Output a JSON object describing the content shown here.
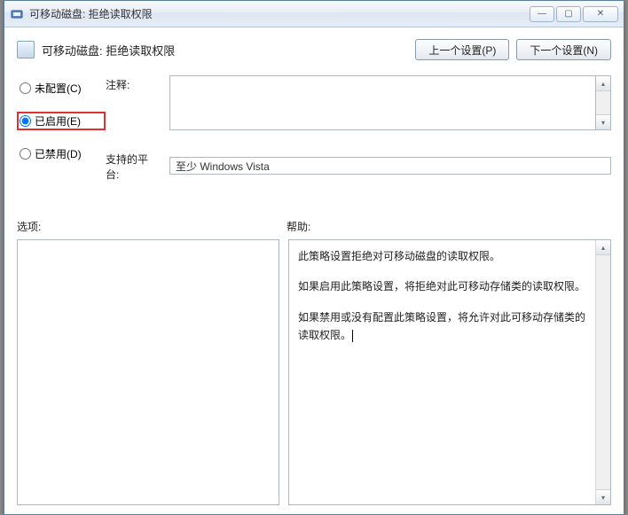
{
  "window": {
    "title": "可移动磁盘: 拒绝读取权限"
  },
  "header": {
    "title": "可移动磁盘: 拒绝读取权限",
    "prev_btn": "上一个设置(P)",
    "next_btn": "下一个设置(N)"
  },
  "radios": {
    "not_configured": "未配置(C)",
    "enabled": "已启用(E)",
    "disabled": "已禁用(D)",
    "selected": "enabled"
  },
  "labels": {
    "comment": "注释:",
    "platform": "支持的平台:",
    "options": "选项:",
    "help": "帮助:"
  },
  "platform_value": "至少 Windows Vista",
  "help_text": {
    "p1": "此策略设置拒绝对可移动磁盘的读取权限。",
    "p2": "如果启用此策略设置，将拒绝对此可移动存储类的读取权限。",
    "p3": "如果禁用或没有配置此策略设置，将允许对此可移动存储类的读取权限。"
  }
}
